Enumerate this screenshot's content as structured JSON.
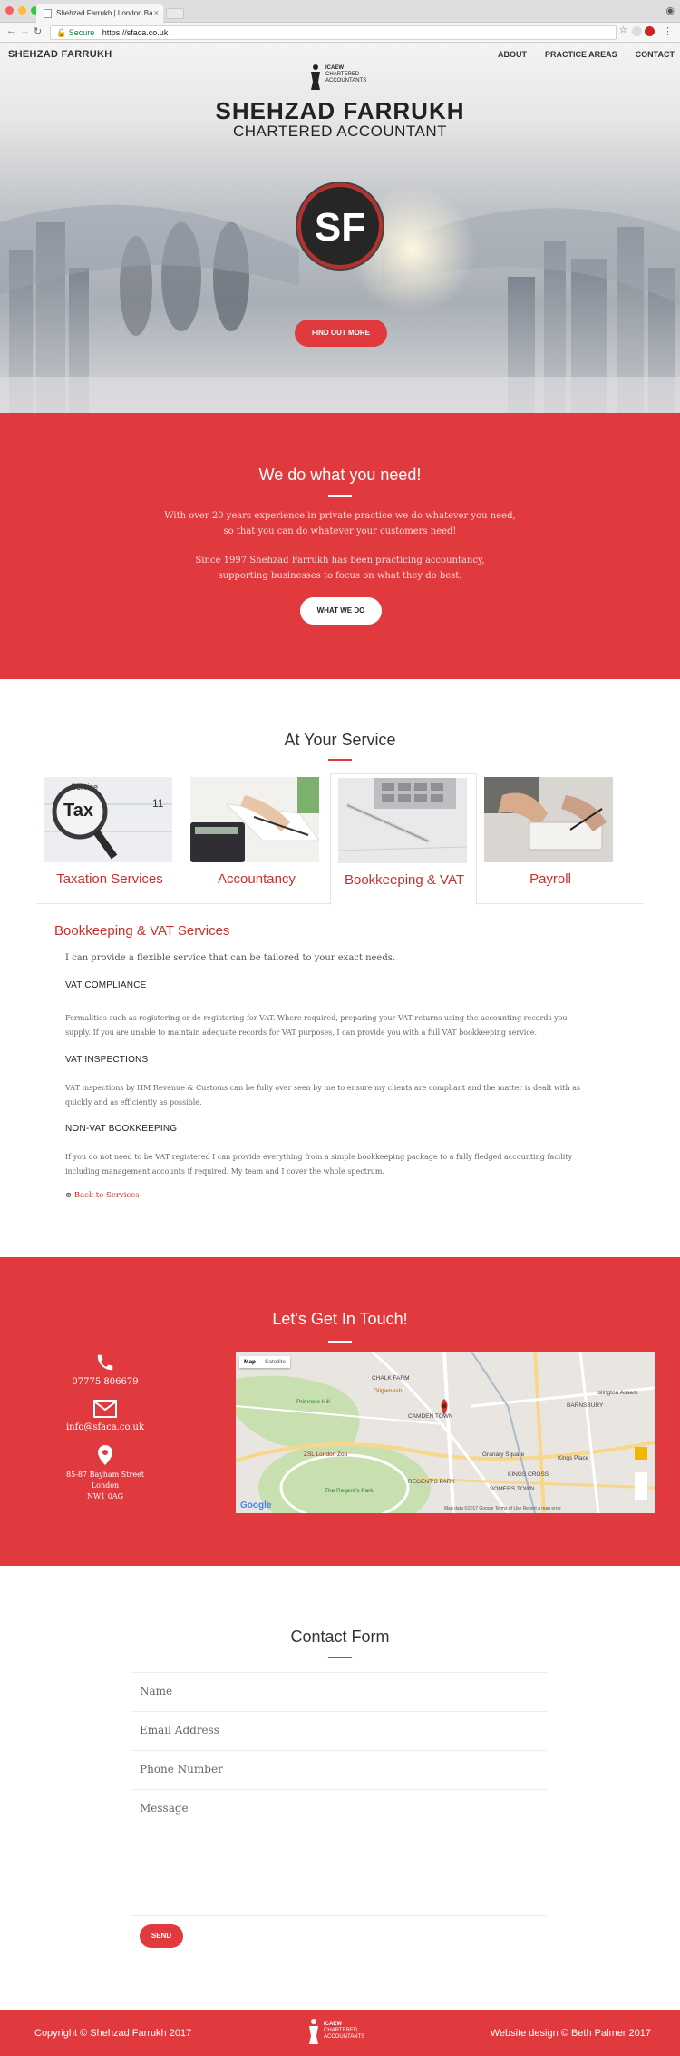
{
  "browser": {
    "tab_title": "Shehzad Farrukh | London Ba...",
    "tab_close": "×",
    "secure_label": "Secure",
    "url": "https://sfaca.co.uk"
  },
  "site": {
    "brand": "SHEHZAD FARRUKH",
    "nav": [
      "ABOUT",
      "PRACTICE AREAS",
      "CONTACT"
    ]
  },
  "hero": {
    "logo_lines": [
      "ICAEW",
      "CHARTERED",
      "ACCOUNTANTS"
    ],
    "name": "SHEHZAD FARRUKH",
    "subtitle": "CHARTERED ACCOUNTANT",
    "badge": "SF",
    "cta": "FIND OUT MORE"
  },
  "wedo": {
    "title": "We do what you need!",
    "para1_line1": "With over 20 years experience in private practice we do whatever you need,",
    "para1_line2": "so that you can do whatever your customers need!",
    "para2_line1": "Since 1997 Shehzad Farrukh has been practicing accountancy,",
    "para2_line2": "supporting businesses to focus on what they do best.",
    "cta": "WHAT WE DO"
  },
  "services": {
    "title": "At Your Service",
    "tabs": [
      "Taxation Services",
      "Accountancy",
      "Bookkeeping & VAT",
      "Payroll"
    ],
    "image_text": {
      "tax": "Tax",
      "service": "Service",
      "number": "11"
    },
    "detail": {
      "title": "Bookkeeping & VAT Services",
      "lead": "I can provide a flexible service that can be tailored to your exact needs.",
      "h1": "VAT COMPLIANCE",
      "p1_line1": "Formalities such as registering or de-registering for VAT. Where required, preparing your VAT returns using the accounting records you",
      "p1_line2": "supply. If you are unable to maintain adequate records for VAT purposes, I can provide you with a full VAT bookkeeping service.",
      "h2": "VAT INSPECTIONS",
      "p2_line1": "VAT inspections by HM Revenue & Customs can be fully over seen by me to ensure my clients are compliant and the matter is dealt with as",
      "p2_line2": "quickly and as efficiently as possible.",
      "h3": "NON-VAT BOOKKEEPING",
      "p3_line1": "If you do not need to be VAT registered I can provide everything from a simple bookkeeping package to a fully fledged accounting facility",
      "p3_line2": "including management accounts if required. My team and I cover the whole spectrum.",
      "back_icon": "⊛",
      "back": "Back to Services"
    }
  },
  "contact": {
    "title": "Let's Get In Touch!",
    "phone": "07775 806679",
    "email": "info@sfaca.co.uk",
    "address_line1": "85-87 Bayham Street",
    "address_line2": "London",
    "address_line3": "NW1 0AG",
    "icons": [
      "phone-icon",
      "envelope-icon",
      "map-pin-icon"
    ],
    "map": {
      "tab_map": "Map",
      "tab_satellite": "Satellite",
      "labels": {
        "chalk_farm": "CHALK FARM",
        "camden": "CAMDEN TOWN",
        "barnsbury": "BARNSBURY",
        "islington": "Islington Assem",
        "zsl": "ZSL London Zoo",
        "granary": "Granary Square",
        "kings_place": "Kings Place",
        "kings_cross": "KINGS CROSS",
        "regents": "REGENT'S PARK",
        "somers": "SOMERS TOWN",
        "the_regents_park": "The Regent's Park",
        "primrose": "Primrose Hill",
        "gilgamesh": "Gilgamesh"
      },
      "google": "Google",
      "footer": "Map data ©2017 Google   Terms of Use   Report a map error"
    }
  },
  "form": {
    "title": "Contact Form",
    "name_placeholder": "Name",
    "email_placeholder": "Email Address",
    "phone_placeholder": "Phone Number",
    "message_placeholder": "Message",
    "send": "SEND"
  },
  "footer": {
    "copyright": "Copyright © Shehzad Farrukh 2017",
    "credit": "Website design © Beth Palmer 2017",
    "logo_lines": [
      "ICAEW",
      "CHARTERED",
      "ACCOUNTANTS"
    ]
  },
  "colors": {
    "brand_red": "#e03a3e",
    "link_red": "#c9302c"
  }
}
